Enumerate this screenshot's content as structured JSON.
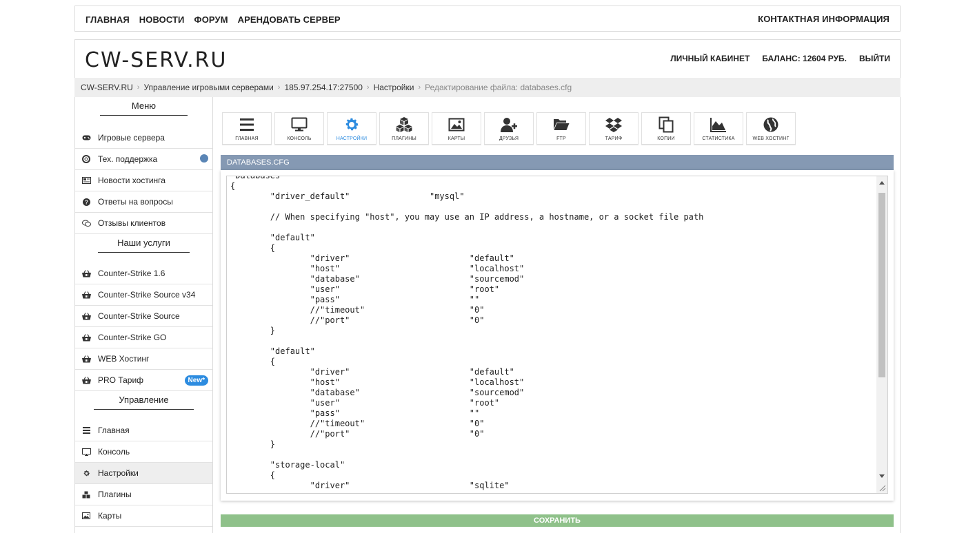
{
  "topnav": {
    "links": [
      "ГЛАВНАЯ",
      "НОВОСТИ",
      "ФОРУМ",
      "АРЕНДОВАТЬ СЕРВЕР"
    ],
    "contact": "КОНТАКТНАЯ ИНФОРМАЦИЯ"
  },
  "header": {
    "logo": "CW-SERV.RU",
    "account": "ЛИЧНЫЙ КАБИНЕТ",
    "balance": "БАЛАНС: 12604 РУБ.",
    "logout": "ВЫЙТИ"
  },
  "breadcrumb": [
    "CW-SERV.RU",
    "Управление игровыми серверами",
    "185.97.254.17:27500",
    "Настройки",
    "Редактирование файла: databases.cfg"
  ],
  "sidebar": {
    "menu_title": "Меню",
    "menu": [
      {
        "label": "Игровые сервера",
        "icon": "gamepad-icon"
      },
      {
        "label": "Тех. поддержка",
        "icon": "lifebuoy-icon"
      },
      {
        "label": "Новости хостинга",
        "icon": "newspaper-icon"
      },
      {
        "label": "Ответы на вопросы",
        "icon": "question-icon"
      },
      {
        "label": "Отзывы клиентов",
        "icon": "comments-icon"
      }
    ],
    "services_title": "Наши услуги",
    "services": [
      {
        "label": "Counter-Strike 1.6",
        "icon": "basket-icon"
      },
      {
        "label": "Counter-Strike Source v34",
        "icon": "basket-icon"
      },
      {
        "label": "Counter-Strike Source",
        "icon": "basket-icon"
      },
      {
        "label": "Counter-Strike GO",
        "icon": "basket-icon"
      },
      {
        "label": "WEB Хостинг",
        "icon": "basket-icon"
      },
      {
        "label": "PRO Тариф",
        "icon": "basket-icon",
        "badge": "New*"
      }
    ],
    "manage_title": "Управление",
    "manage": [
      {
        "label": "Главная",
        "icon": "bars-icon"
      },
      {
        "label": "Консоль",
        "icon": "monitor-icon"
      },
      {
        "label": "Настройки",
        "icon": "gear-icon"
      },
      {
        "label": "Плагины",
        "icon": "cubes-icon"
      },
      {
        "label": "Карты",
        "icon": "image-icon"
      }
    ]
  },
  "toolbar": [
    {
      "label": "ГЛАВНАЯ",
      "icon": "bars-icon"
    },
    {
      "label": "КОНСОЛЬ",
      "icon": "monitor-icon"
    },
    {
      "label": "НАСТРОЙКИ",
      "icon": "gear-icon"
    },
    {
      "label": "ПЛАГИНЫ",
      "icon": "cubes-icon"
    },
    {
      "label": "КАРТЫ",
      "icon": "image-icon"
    },
    {
      "label": "ДРУЗЬЯ",
      "icon": "user-plus-icon"
    },
    {
      "label": "FTP",
      "icon": "folder-open-icon"
    },
    {
      "label": "ТАРИФ",
      "icon": "dropbox-icon"
    },
    {
      "label": "КОПИИ",
      "icon": "copy-icon"
    },
    {
      "label": "СТАТИСТИКА",
      "icon": "area-chart-icon"
    },
    {
      "label": "WEB ХОСТИНГ",
      "icon": "globe-icon"
    }
  ],
  "panel_title": "DATABASES.CFG",
  "editor": {
    "content": "\"Databases\"\n{\n\t\"driver_default\"\t\t\"mysql\"\n\n\t// When specifying \"host\", you may use an IP address, a hostname, or a socket file path\n\n\t\"default\"\n\t{\n\t\t\"driver\"\t\t\t\"default\"\n\t\t\"host\"\t\t\t\t\"localhost\"\n\t\t\"database\"\t\t\t\"sourcemod\"\n\t\t\"user\"\t\t\t\t\"root\"\n\t\t\"pass\"\t\t\t\t\"\"\n\t\t//\"timeout\"\t\t\t\"0\"\n\t\t//\"port\"\t\t\t\"0\"\n\t}\n\n\t\"default\"\n\t{\n\t\t\"driver\"\t\t\t\"default\"\n\t\t\"host\"\t\t\t\t\"localhost\"\n\t\t\"database\"\t\t\t\"sourcemod\"\n\t\t\"user\"\t\t\t\t\"root\"\n\t\t\"pass\"\t\t\t\t\"\"\n\t\t//\"timeout\"\t\t\t\"0\"\n\t\t//\"port\"\t\t\t\"0\"\n\t}\n\n\t\"storage-local\"\n\t{\n\t\t\"driver\"\t\t\t\"sqlite\""
  },
  "save_label": "СОХРАНИТЬ",
  "colors": {
    "accent": "#2d8ce0",
    "panel": "#8599b3",
    "save": "#8fc18a"
  }
}
